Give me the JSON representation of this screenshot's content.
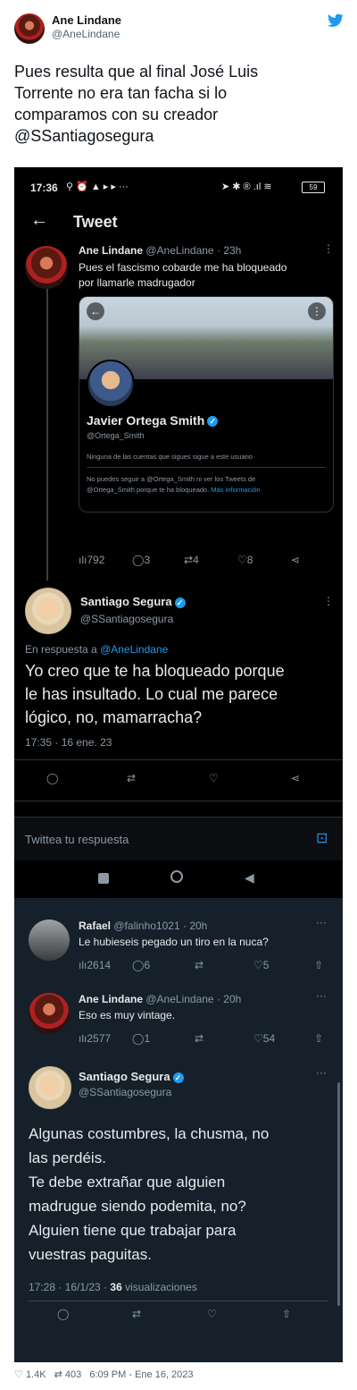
{
  "outer": {
    "name": "Ane Lindane",
    "handle": "@AneLindane",
    "text_lines": [
      "Pues resulta que al final José Luis",
      "Torrente no era tan facha si lo",
      "comparamos con su creador",
      "@SSantiagosegura"
    ],
    "footer": {
      "likes": "1.4K",
      "retweets": "403",
      "time": "6:09 PM - Ene 16, 2023"
    }
  },
  "screenshot": {
    "status_bar": {
      "time": "17:36",
      "battery": "59"
    },
    "header_title": "Tweet",
    "tweet1": {
      "name": "Ane Lindane",
      "handle": "@AneLindane",
      "time": "23h",
      "text_lines": [
        "Pues el fascismo cobarde me ha bloqueado",
        "por llamarle madrugador"
      ],
      "card": {
        "name": "Javier Ortega Smith",
        "handle": "@Ortega_Smith",
        "followers_note": "Ninguna de las cuentas que sigues sigue a este usuario",
        "blocked_line1": "No puedes seguir a @Ortega_Smith ni ver los Tweets de",
        "blocked_line2": "@Ortega_Smith porque te ha bloqueado.",
        "more_info": "Más información"
      },
      "stats": {
        "views": "792",
        "replies": "3",
        "retweets": "4",
        "likes": "8"
      }
    },
    "tweet2": {
      "name": "Santiago Segura",
      "handle": "@SSantiagosegura",
      "reply_prefix": "En respuesta a",
      "reply_to": "@AneLindane",
      "text_lines": [
        "Yo creo que te ha bloqueado porque",
        "le has insultado. Lo cual me parece",
        "lógico, no, mamarracha?"
      ],
      "timestamp": "17:35 · 16 ene. 23"
    },
    "reply_placeholder": "Twittea tu respuesta",
    "reply_rafael": {
      "name": "Rafael",
      "handle": "@falinho1021",
      "time": "20h",
      "text": "Le hubieseis pegado un tiro en la nuca?",
      "stats": {
        "views": "2614",
        "replies": "6",
        "likes": "5"
      }
    },
    "reply_ane": {
      "name": "Ane Lindane",
      "handle": "@AneLindane",
      "time": "20h",
      "text": "Eso es muy vintage.",
      "stats": {
        "views": "2577",
        "replies": "1",
        "likes": "54"
      }
    },
    "tweet3": {
      "name": "Santiago Segura",
      "handle": "@SSantiagosegura",
      "text_lines": [
        "Algunas costumbres, la chusma, no",
        "las perdéis.",
        "Te debe extrañar que alguien",
        "madrugue siendo podemita, no?",
        "Alguien tiene que trabajar para",
        "vuestras paguitas."
      ],
      "timestamp": "17:28 · 16/1/23 · ",
      "views_count": "36",
      "views_label": "visualizaciones"
    }
  }
}
